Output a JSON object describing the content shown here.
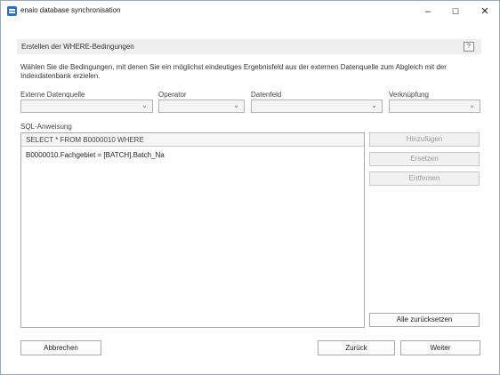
{
  "window": {
    "title": "enaio database synchronisation",
    "minimize": "–",
    "maximize": "☐",
    "close": "✕"
  },
  "section": {
    "title": "Erstellen der WHERE-Bedingungen",
    "help": "?"
  },
  "description": "Wählen Sie die Bedingungen, mit denen Sie ein möglichst eindeutiges Ergebnisfeld aus der externen Datenquelle zum Abgleich mit der Indexdatenbank erzielen.",
  "fields": {
    "external_source": {
      "label": "Externe Datenquelle",
      "value": ""
    },
    "operator": {
      "label": "Operator",
      "value": ""
    },
    "datafield": {
      "label": "Datenfeld",
      "value": ""
    },
    "link": {
      "label": "Verknüpfung",
      "value": ""
    }
  },
  "sql": {
    "label": "SQL-Anweisung",
    "header": "SELECT * FROM B0000010 WHERE",
    "lines": [
      "B0000010.Fachgebiet = [BATCH].Batch_Na"
    ]
  },
  "buttons": {
    "add": "Hinzufügen",
    "replace": "Ersetzen",
    "remove": "Entfernen",
    "reset_all": "Alle zurücksetzen",
    "cancel": "Abbrechen",
    "back": "Zurück",
    "next": "Weiter"
  },
  "icons": {
    "app": "database-icon",
    "chevron": "chevron-down-icon"
  }
}
